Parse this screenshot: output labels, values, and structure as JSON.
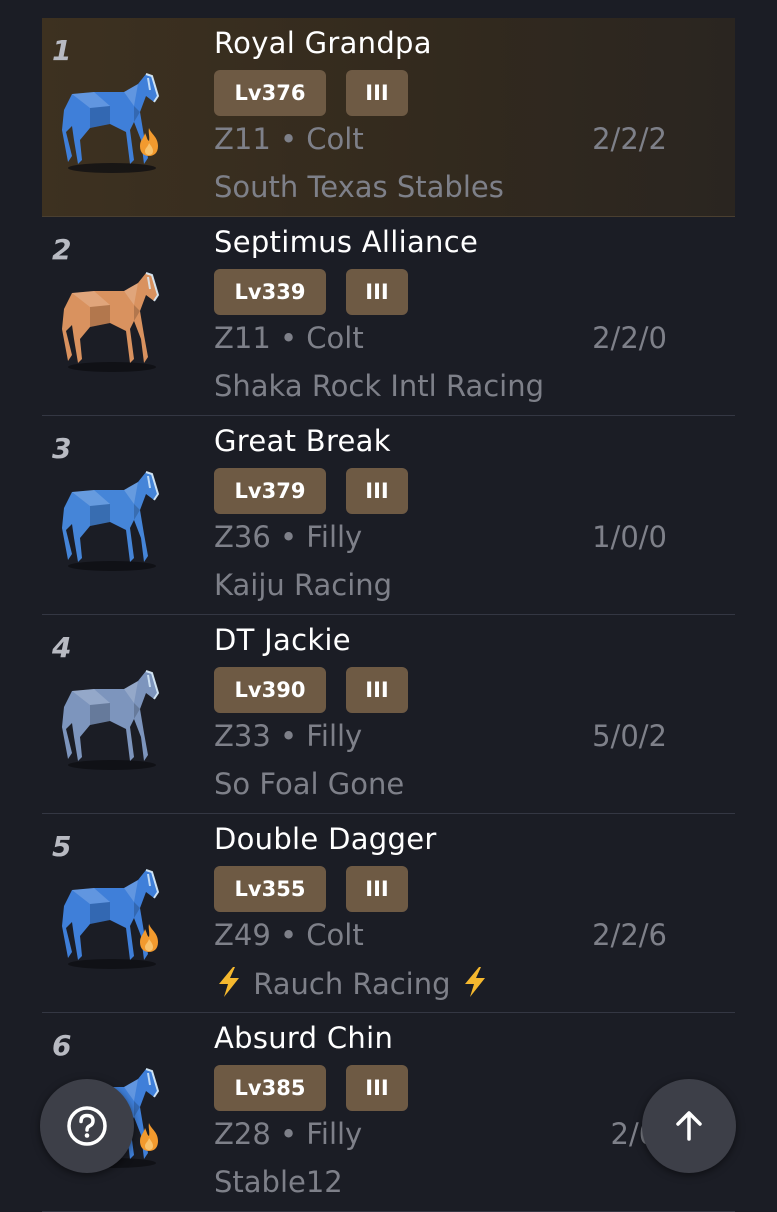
{
  "horses": [
    {
      "rank": "1",
      "name": "Royal Grandpa",
      "level": "Lv376",
      "grade": "III",
      "meta": "Z11 • Colt",
      "record": "2/2/2",
      "stable": "South Texas Stables",
      "color": "#3f7fd9",
      "flame": true,
      "bolts": false,
      "highlight": true
    },
    {
      "rank": "2",
      "name": "Septimus Alliance",
      "level": "Lv339",
      "grade": "III",
      "meta": "Z11 • Colt",
      "record": "2/2/0",
      "stable": "Shaka Rock Intl Racing",
      "color": "#d9925f",
      "flame": false,
      "bolts": false,
      "highlight": false
    },
    {
      "rank": "3",
      "name": "Great Break",
      "level": "Lv379",
      "grade": "III",
      "meta": "Z36 • Filly",
      "record": "1/0/0",
      "stable": "Kaiju Racing",
      "color": "#4585d8",
      "flame": false,
      "bolts": false,
      "highlight": false
    },
    {
      "rank": "4",
      "name": "DT Jackie",
      "level": "Lv390",
      "grade": "III",
      "meta": "Z33 • Filly",
      "record": "5/0/2",
      "stable": "So Foal Gone",
      "color": "#7d95bd",
      "flame": false,
      "bolts": false,
      "highlight": false
    },
    {
      "rank": "5",
      "name": "Double Dagger",
      "level": "Lv355",
      "grade": "III",
      "meta": "Z49 • Colt",
      "record": "2/2/6",
      "stable": "Rauch Racing",
      "color": "#3f7fd9",
      "flame": true,
      "bolts": true,
      "highlight": false
    },
    {
      "rank": "6",
      "name": "Absurd Chin",
      "level": "Lv385",
      "grade": "III",
      "meta": "Z28 • Filly",
      "record": "2/0/",
      "stable": "Stable12",
      "color": "#3f7fd9",
      "flame": true,
      "bolts": false,
      "highlight": false
    }
  ],
  "icons": {
    "help": "question-circle-icon",
    "up": "arrow-up-icon",
    "flame": "fire-icon",
    "bolt": "lightning-icon",
    "horse": "horse-icon"
  },
  "colors": {
    "background": "#1b1d25",
    "badge": "#6e5a44",
    "highlight_row": "#3d3120",
    "muted_text": "#7e8089",
    "bolt": "#f5b82e",
    "flame": "#f29a2e"
  }
}
